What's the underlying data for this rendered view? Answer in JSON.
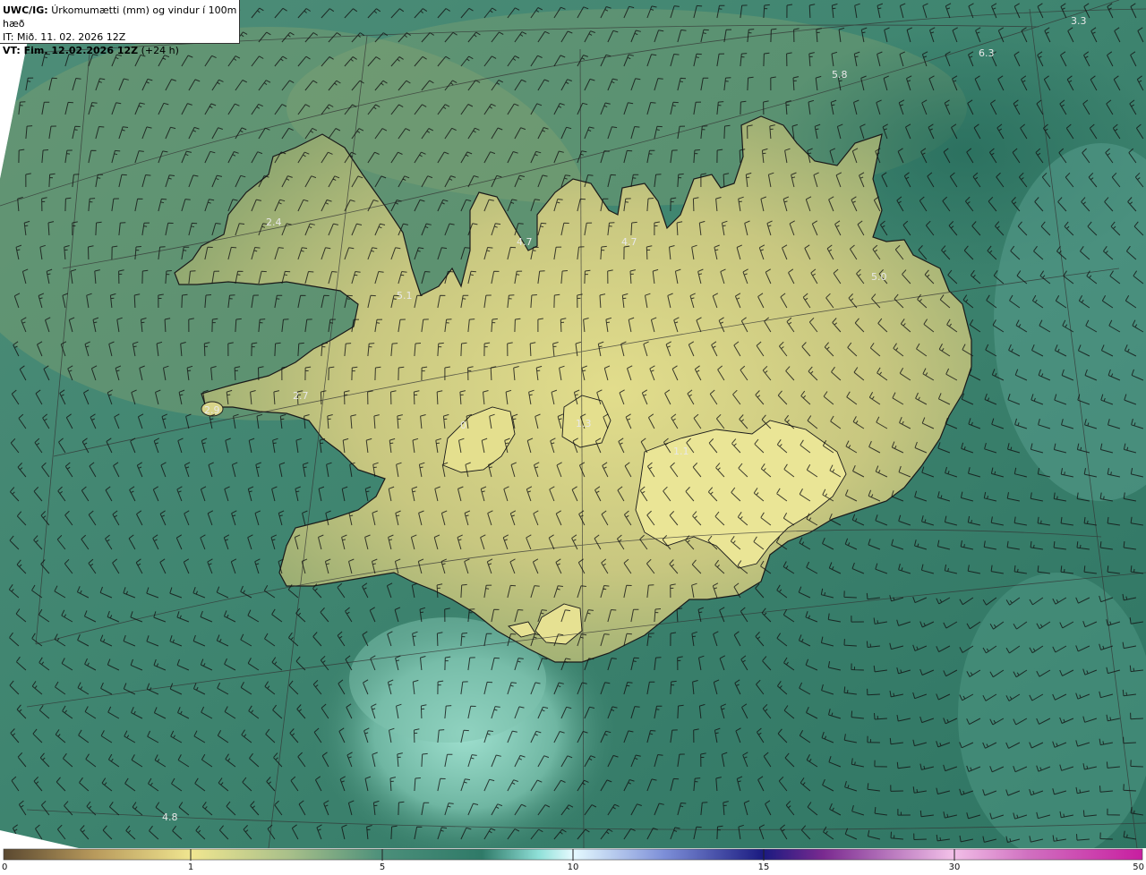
{
  "header": {
    "model": "UWC/IG:",
    "title": "Úrkomumætti (mm) og vindur í 100m hæð",
    "initial_time": "IT: Mið. 11. 02. 2026 12Z",
    "valid_label": "VT: Fim. 12.02.2026 12Z",
    "valid_offset": "(+24 h)"
  },
  "map": {
    "region": "Iceland",
    "field": "precipitable water",
    "overlay": "wind barbs at 100 m",
    "colors": {
      "ocean_dark": "#2f7a68",
      "sea_teal": "#4b8f7a",
      "land_green": "#93a56f",
      "land_yellow": "#e3df8c",
      "plume_light": "#8fd0c0",
      "coastline": "#1a1a1a",
      "grid": "#3a3a3a",
      "barb": "#111111"
    }
  },
  "value_labels": [
    "3.3",
    "6.3",
    "5.8",
    "2.4",
    "4.7",
    "4.7",
    "5.1",
    "5.0",
    "2.7",
    "2.9",
    "0",
    "1.3",
    "1.1",
    "4.8"
  ],
  "colorbar": {
    "ticks": [
      "0",
      "1",
      "5",
      "10",
      "15",
      "30",
      "50"
    ],
    "colors": [
      "#5a4830",
      "#b89a5c",
      "#f0e690",
      "#a9c08a",
      "#4b8f7a",
      "#2f7a68",
      "#8fe0d8",
      "#e6fbff",
      "#7d8fd8",
      "#1a1a80",
      "#7a2a90",
      "#d070c0",
      "#f2c0e8",
      "#c81ea0"
    ]
  }
}
